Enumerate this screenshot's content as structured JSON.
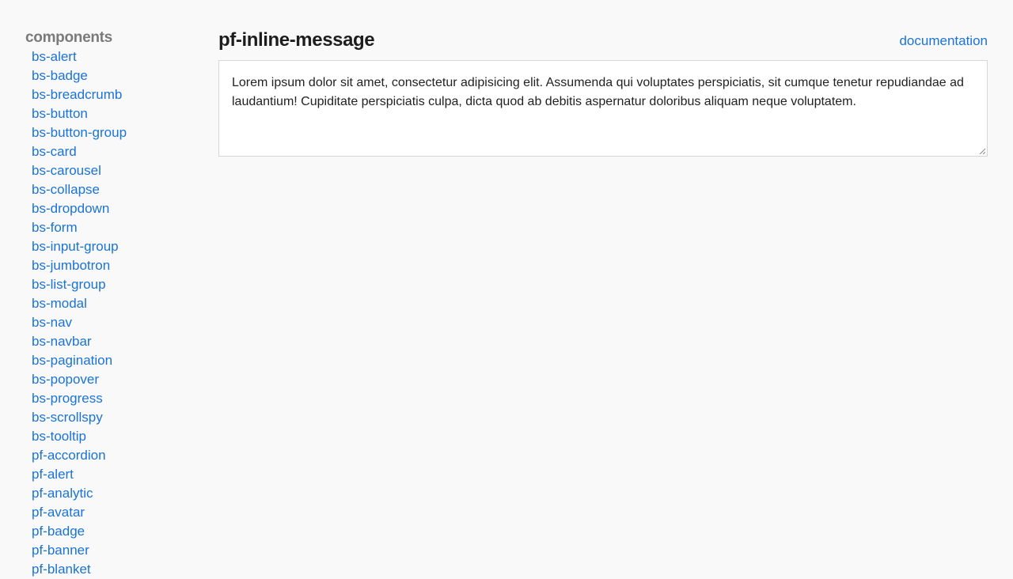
{
  "sidebar": {
    "heading": "components",
    "items": [
      "bs-alert",
      "bs-badge",
      "bs-breadcrumb",
      "bs-button",
      "bs-button-group",
      "bs-card",
      "bs-carousel",
      "bs-collapse",
      "bs-dropdown",
      "bs-form",
      "bs-input-group",
      "bs-jumbotron",
      "bs-list-group",
      "bs-modal",
      "bs-nav",
      "bs-navbar",
      "bs-pagination",
      "bs-popover",
      "bs-progress",
      "bs-scrollspy",
      "bs-tooltip",
      "pf-accordion",
      "pf-alert",
      "pf-analytic",
      "pf-avatar",
      "pf-badge",
      "pf-banner",
      "pf-blanket"
    ]
  },
  "main": {
    "title": "pf-inline-message",
    "doc_link": "documentation",
    "message": "Lorem ipsum dolor sit amet, consectetur adipisicing elit. Assumenda qui voluptates perspiciatis, sit cumque tenetur repudiandae ad laudantium! Cupiditate perspiciatis culpa, dicta quod ab debitis aspernatur doloribus aliquam neque voluptatem."
  },
  "colors": {
    "background": "#f9f9f9",
    "link": "#1a73d9",
    "heading_muted": "#7a7a7a",
    "title": "#1d1d1d",
    "border": "#d6d6d6"
  },
  "icons": {
    "resize": "resize-handle-icon"
  }
}
